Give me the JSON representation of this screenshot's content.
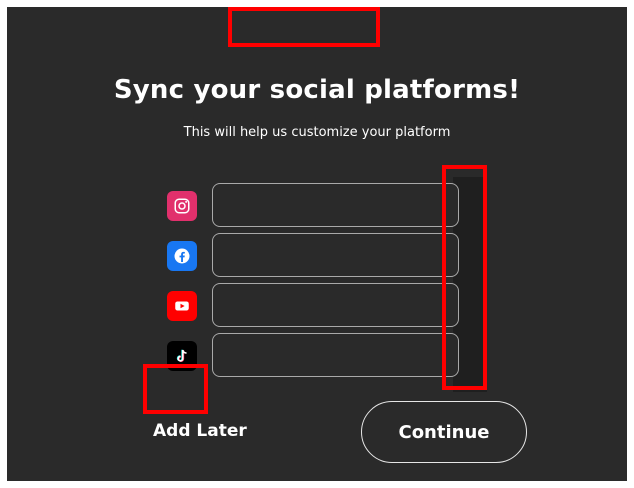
{
  "header": {
    "title": "Sync your social platforms!",
    "subtitle": "This will help us customize your platform"
  },
  "platforms": [
    {
      "name": "instagram",
      "icon": "instagram-icon",
      "color": "#e1306c",
      "value": "",
      "placeholder": ""
    },
    {
      "name": "facebook",
      "icon": "facebook-icon",
      "color": "#1877f2",
      "value": "",
      "placeholder": ""
    },
    {
      "name": "youtube",
      "icon": "youtube-icon",
      "color": "#ff0000",
      "value": "",
      "placeholder": ""
    },
    {
      "name": "tiktok",
      "icon": "tiktok-icon",
      "color": "#000000",
      "value": "",
      "placeholder": ""
    }
  ],
  "actions": {
    "add_later_label": "Add Later",
    "continue_label": "Continue"
  },
  "colors": {
    "background": "#2a2a2a",
    "annotation": "#ff0000"
  }
}
